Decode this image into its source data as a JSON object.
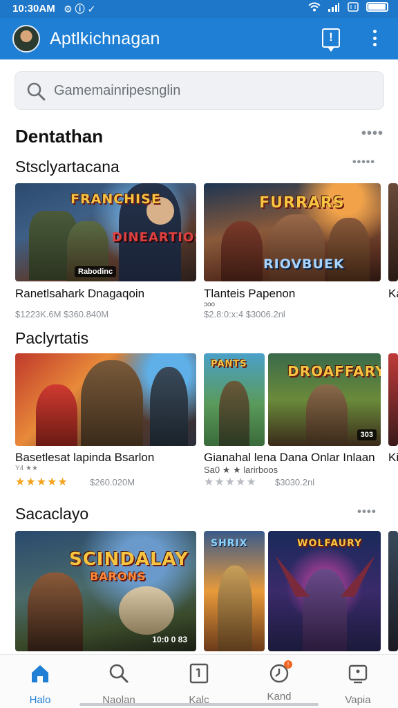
{
  "status": {
    "time": "10:30AM",
    "left_icons": [
      "gear-icon",
      "circle-icon",
      "check-icon"
    ],
    "right_icons": [
      "wifi-icon",
      "signal-icon",
      "sim-icon"
    ],
    "battery_level": 0.9
  },
  "app_bar": {
    "title": "Aptlkichnagan",
    "alert_icon_glyph": "!",
    "more_icon": "more-vertical-icon"
  },
  "search": {
    "placeholder": "Gamemainripesnglin"
  },
  "page": {
    "heading": "Dentathan"
  },
  "sections": [
    {
      "title": "Stsclyartacana",
      "cards": [
        {
          "art_text": "FRANCHISE",
          "art_sub": "DINEARTIOS",
          "badge": "Rabodinc",
          "title": "Ranetlsahark Dnagaqoin",
          "meta": "$1223K.6M   $360.840M"
        },
        {
          "art_text": "FURRARS",
          "art_sub": "RIOVBUEK",
          "small": "ɔoo",
          "title": "Tlanteis Papenon",
          "meta": "$2.8:0:x:4   $3006.2nl"
        },
        {
          "title": "Ka"
        }
      ]
    },
    {
      "title": "Paclyrtatis",
      "cards": [
        {
          "small": "Y4 ★★",
          "title": "Basetlesat lapinda Bsarlon",
          "rating": 5,
          "meta": "$260.020M"
        },
        {
          "art_text": "PANTS",
          "title": "Gianahal lena Dana Onlar Inlaan",
          "small": "Sa0 ★ ★ larirboos",
          "rating": 0,
          "meta": "$3030.2nl"
        },
        {
          "art_text": "DROAFFARY",
          "badge": "303"
        },
        {
          "title": "Ki"
        }
      ]
    },
    {
      "title": "Sacaclayo",
      "cards": [
        {
          "art_text": "SCINDALAY",
          "art_sub": "BARONS",
          "badge": "10:0 0 83"
        },
        {
          "art_text": "SHRIX"
        },
        {
          "art_text": "WOLFAURY"
        }
      ]
    }
  ],
  "nav": {
    "items": [
      {
        "label": "Halo",
        "icon": "home-icon",
        "active": true
      },
      {
        "label": "Naolan",
        "icon": "search-icon",
        "active": false
      },
      {
        "label": "Kalc",
        "icon": "bookmark-icon",
        "active": false
      },
      {
        "label": "Kand",
        "icon": "clock-icon",
        "active": false,
        "badge": "!"
      },
      {
        "label": "Vapia",
        "icon": "profile-icon",
        "active": false
      }
    ]
  },
  "colors": {
    "accent": "#1f7fd4",
    "status_bar": "#1e77c9",
    "star": "#f2a31b"
  }
}
